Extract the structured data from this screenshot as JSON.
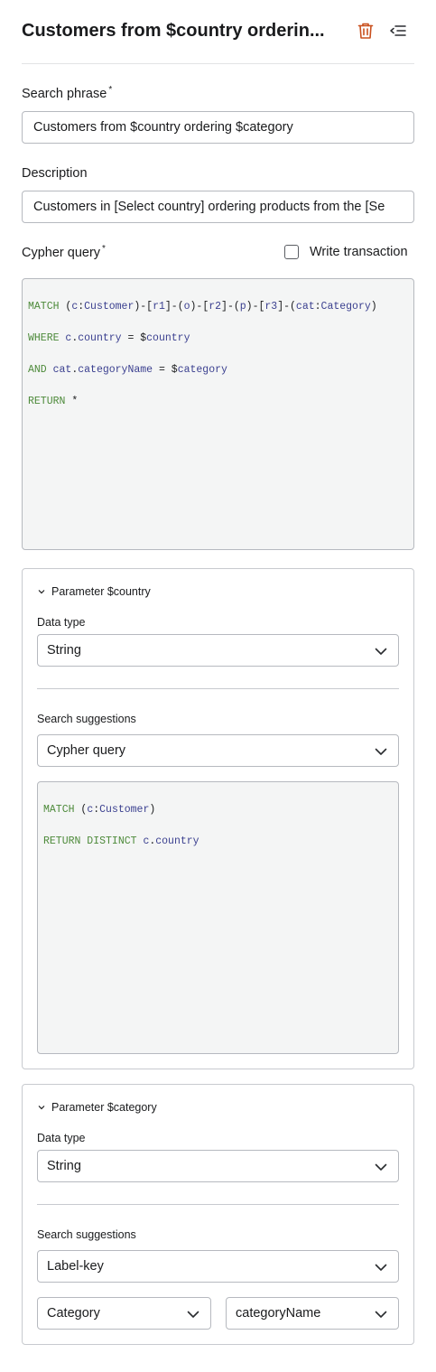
{
  "header": {
    "title": "Customers from $country orderin...",
    "delete_icon": "trash-icon",
    "collapse_icon": "collapse-menu-icon",
    "delete_color": "#c9501e"
  },
  "fields": {
    "search_phrase_label": "Search phrase",
    "search_phrase_value": "Customers from $country ordering $category",
    "description_label": "Description",
    "description_value": "Customers in [Select country] ordering products from the [Se",
    "cypher_label": "Cypher query",
    "required_mark": "*",
    "write_tx_label": "Write transaction",
    "write_tx_checked": false
  },
  "cypher": {
    "lines": [
      "MATCH (c:Customer)-[r1]-(o)-[r2]-(p)-[r3]-(cat:Category)",
      "WHERE c.country = $country",
      "AND cat.categoryName = $category",
      "RETURN *"
    ]
  },
  "param_country": {
    "title": "Parameter $country",
    "data_type_label": "Data type",
    "data_type_value": "String",
    "suggestions_label": "Search suggestions",
    "suggestions_value": "Cypher query",
    "query_lines": [
      "MATCH (c:Customer)",
      "RETURN DISTINCT c.country"
    ]
  },
  "param_category": {
    "title": "Parameter $category",
    "data_type_label": "Data type",
    "data_type_value": "String",
    "suggestions_label": "Search suggestions",
    "suggestions_value": "Label-key",
    "label_value": "Category",
    "key_value": "categoryName"
  }
}
